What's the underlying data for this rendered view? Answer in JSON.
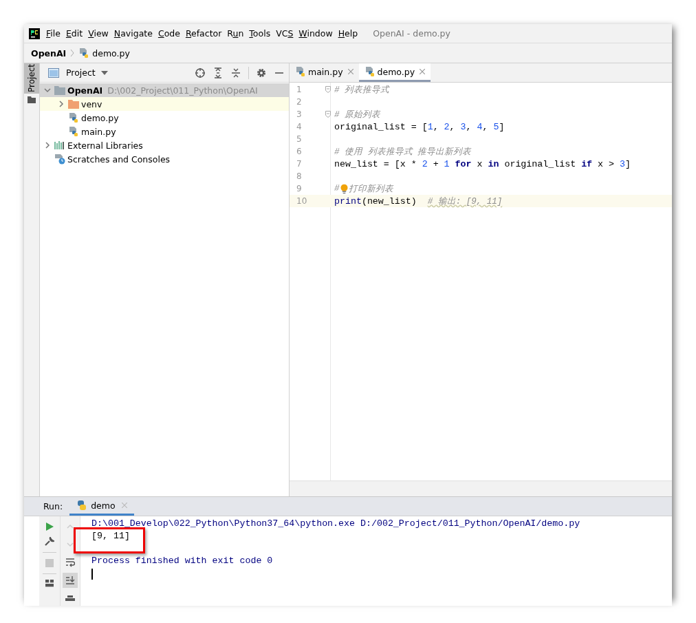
{
  "window": {
    "title": "OpenAI - demo.py"
  },
  "menu": [
    {
      "key": "F",
      "after": "ile"
    },
    {
      "key": "E",
      "after": "dit"
    },
    {
      "key": "V",
      "after": "iew"
    },
    {
      "key": "N",
      "after": "avigate"
    },
    {
      "key": "C",
      "after": "ode"
    },
    {
      "key": "R",
      "after": "efactor"
    },
    {
      "before": "R",
      "key": "u",
      "after": "n"
    },
    {
      "key": "T",
      "after": "ools"
    },
    {
      "before": "VC",
      "key": "S"
    },
    {
      "key": "W",
      "after": "indow"
    },
    {
      "key": "H",
      "after": "elp"
    }
  ],
  "breadcrumb": [
    "OpenAI",
    "demo.py"
  ],
  "side_stripe": {
    "label": "Project",
    "selected": true
  },
  "project_panel": {
    "title": "Project",
    "tree": [
      {
        "label": "OpenAI",
        "path": "D:\\002_Project\\011_Python\\OpenAI",
        "kind": "project",
        "expanded": true,
        "selected": true,
        "excluded": false,
        "children": [
          {
            "label": "venv",
            "kind": "folder",
            "expanded": false,
            "selected": false,
            "excluded": true
          },
          {
            "label": "demo.py",
            "kind": "python",
            "selected": false,
            "excluded": false
          },
          {
            "label": "main.py",
            "kind": "python",
            "selected": false,
            "excluded": false
          }
        ]
      },
      {
        "label": "External Libraries",
        "kind": "libraries",
        "expanded": false,
        "selected": false,
        "excluded": false
      },
      {
        "label": "Scratches and Consoles",
        "kind": "scratches",
        "selected": false,
        "excluded": false
      }
    ]
  },
  "editor": {
    "tabs": [
      {
        "label": "main.py",
        "selected": false
      },
      {
        "label": "demo.py",
        "selected": true
      }
    ],
    "lines": [
      {
        "number": "1",
        "fold": true,
        "current": false,
        "tokens": [
          {
            "text": "# 列表推导式",
            "kind": "comment"
          }
        ]
      },
      {
        "number": "2",
        "fold": false,
        "current": false
      },
      {
        "number": "3",
        "fold": true,
        "current": false,
        "tokens": [
          {
            "text": "# 原始列表",
            "kind": "comment"
          }
        ]
      },
      {
        "number": "4",
        "fold": false,
        "current": false,
        "tokens": [
          {
            "text": "original_list = [",
            "kind": "plain"
          },
          {
            "text": "1",
            "kind": "number"
          },
          {
            "text": ", ",
            "kind": "plain"
          },
          {
            "text": "2",
            "kind": "number"
          },
          {
            "text": ", ",
            "kind": "plain"
          },
          {
            "text": "3",
            "kind": "number"
          },
          {
            "text": ", ",
            "kind": "plain"
          },
          {
            "text": "4",
            "kind": "number"
          },
          {
            "text": ", ",
            "kind": "plain"
          },
          {
            "text": "5",
            "kind": "number"
          },
          {
            "text": "]",
            "kind": "plain"
          }
        ]
      },
      {
        "number": "5",
        "fold": false,
        "current": false
      },
      {
        "number": "6",
        "fold": false,
        "current": false,
        "tokens": [
          {
            "text": "# 使用 列表推导式 推导出新列表",
            "kind": "comment"
          }
        ]
      },
      {
        "number": "7",
        "fold": false,
        "current": false,
        "tokens": [
          {
            "text": "new_list = [x * ",
            "kind": "plain"
          },
          {
            "text": "2",
            "kind": "number"
          },
          {
            "text": " + ",
            "kind": "plain"
          },
          {
            "text": "1",
            "kind": "number"
          },
          {
            "text": " for",
            "kind": "keyword"
          },
          {
            "text": " x ",
            "kind": "plain"
          },
          {
            "text": "in",
            "kind": "keyword"
          },
          {
            "text": " original_list ",
            "kind": "plain"
          },
          {
            "text": "if",
            "kind": "keyword"
          },
          {
            "text": " x > ",
            "kind": "plain"
          },
          {
            "text": "3",
            "kind": "number"
          },
          {
            "text": "]",
            "kind": "plain"
          }
        ]
      },
      {
        "number": "8",
        "fold": false,
        "current": false
      },
      {
        "number": "9",
        "fold": false,
        "current": false,
        "tokens": [
          {
            "text": "#",
            "kind": "comment"
          },
          {
            "kind": "bulb"
          },
          {
            "text": "打印新列表",
            "kind": "comment"
          }
        ]
      },
      {
        "number": "10",
        "fold": false,
        "current": true,
        "tokens": [
          {
            "text": "print",
            "kind": "builtin"
          },
          {
            "text": "(new_list)  ",
            "kind": "plain"
          },
          {
            "text": "# 输出: [9, 11]",
            "kind": "typo-comment"
          }
        ]
      }
    ]
  },
  "run_panel": {
    "label": "Run:",
    "tabs": [
      {
        "label": "demo",
        "selected": true
      }
    ],
    "toolbar": [
      {
        "kind": "run",
        "disabled": false
      },
      {
        "kind": "wrench",
        "disabled": false
      },
      {
        "kind": "stop",
        "disabled": true
      },
      {
        "kind": "layout",
        "disabled": false
      }
    ],
    "toolbar2": [
      {
        "kind": "up",
        "disabled": true,
        "selected": false
      },
      {
        "kind": "down",
        "disabled": true,
        "selected": false
      },
      {
        "kind": "wrap",
        "disabled": false,
        "selected": false
      },
      {
        "kind": "scroll",
        "disabled": false,
        "selected": true
      },
      {
        "kind": "print",
        "disabled": false,
        "selected": false
      }
    ],
    "console": [
      {
        "text": "D:\\001_Develop\\022_Python\\Python37_64\\python.exe D:/002_Project/011_Python/OpenAI/demo.py",
        "kind": "system"
      },
      {
        "text": "[9, 11]",
        "kind": "output",
        "highlighted": true
      },
      {
        "text": "Process finished with exit code 0",
        "kind": "system"
      }
    ]
  }
}
